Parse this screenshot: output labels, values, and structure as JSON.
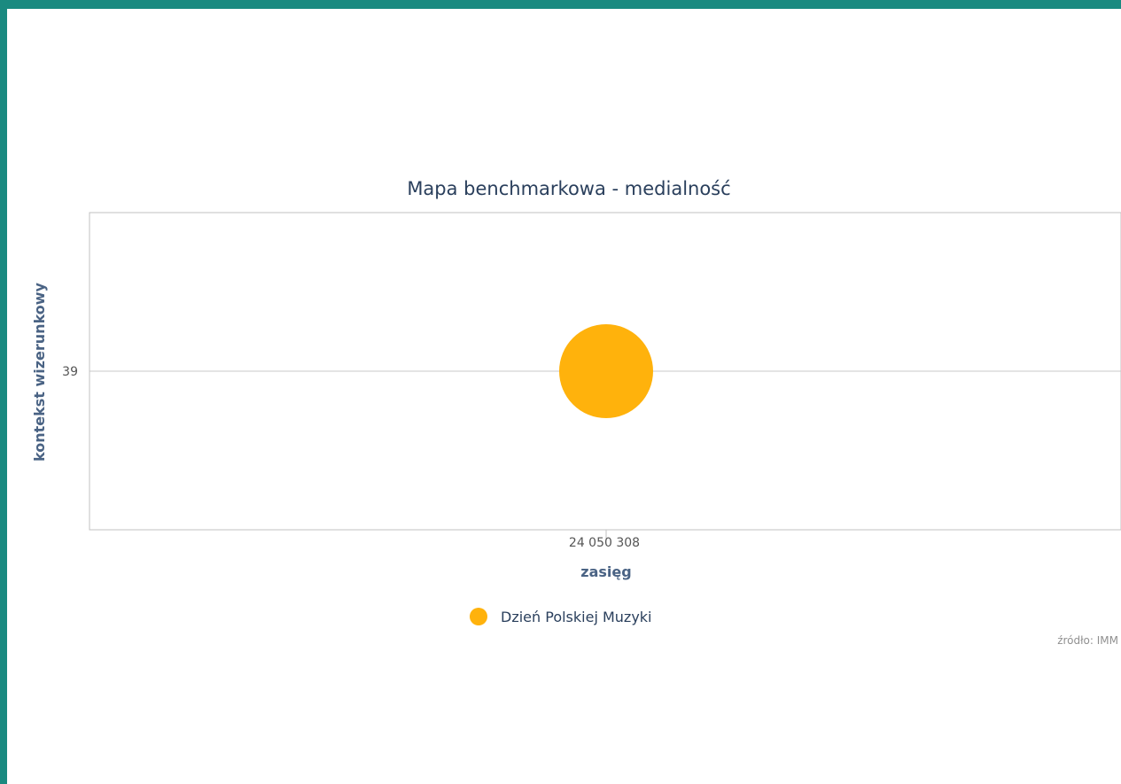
{
  "colors": {
    "background": "#1a8a80",
    "panel": "#ffffff",
    "bubble": "#ffb20c"
  },
  "chart_data": {
    "type": "scatter",
    "title": "Mapa benchmarkowa - medialność",
    "xlabel": "zasięg",
    "ylabel": "kontekst wizerunkowy",
    "x_tick_labels": [
      "24 050 308"
    ],
    "y_tick_labels": [
      "39"
    ],
    "series": [
      {
        "name": "Dzień Polskiej Muzyki",
        "x": 24050308,
        "y": 39
      }
    ],
    "grid": true,
    "legend": "bottom-center",
    "credits": "źródło: IMM"
  }
}
